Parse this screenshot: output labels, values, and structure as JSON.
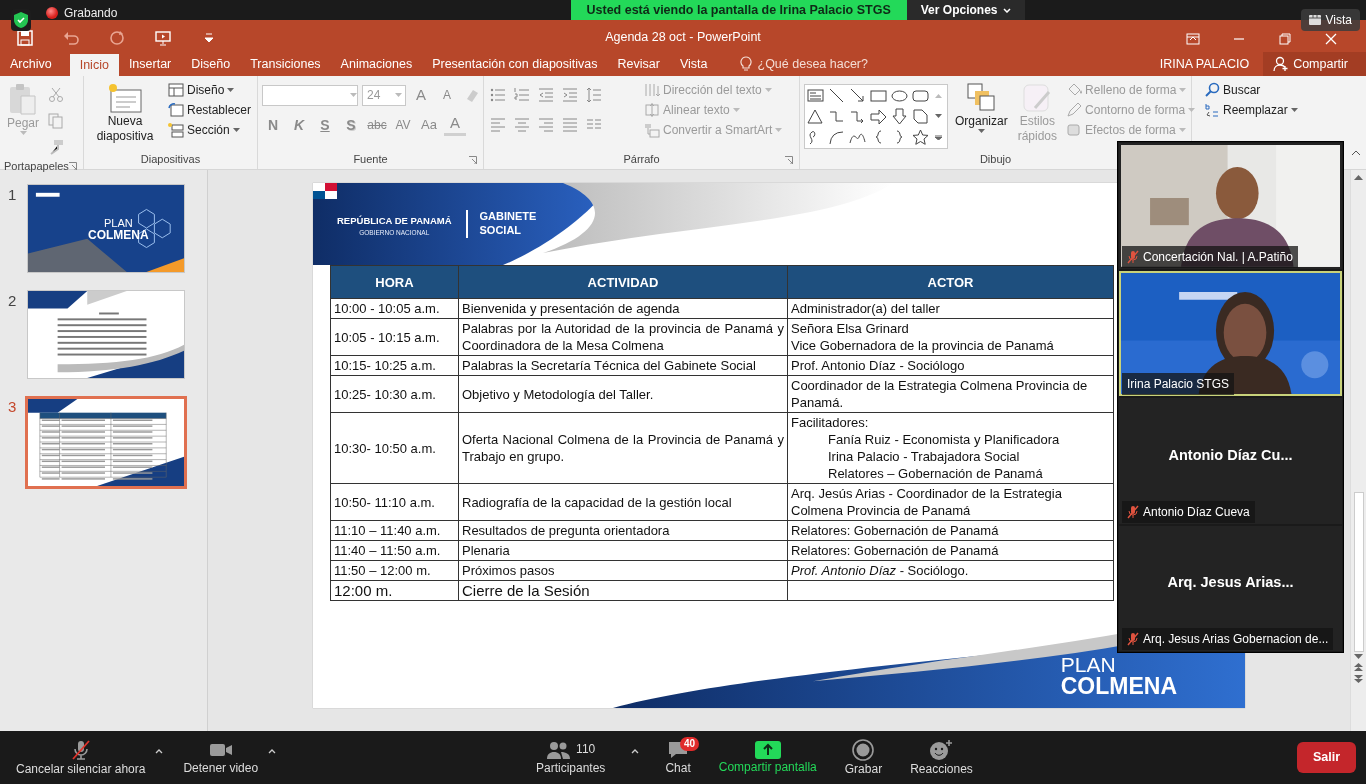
{
  "zoom_bar": {
    "recording_label": "Grabando",
    "banner": "Usted está viendo la pantalla de Irina Palacio STGS",
    "options_button": "Ver Opciones",
    "view_button": "Vista"
  },
  "window": {
    "title": "Agenda 28 oct - PowerPoint"
  },
  "tabs": [
    {
      "label": "Archivo",
      "selected": false
    },
    {
      "label": "Inicio",
      "selected": true
    },
    {
      "label": "Insertar",
      "selected": false
    },
    {
      "label": "Diseño",
      "selected": false
    },
    {
      "label": "Transiciones",
      "selected": false
    },
    {
      "label": "Animaciones",
      "selected": false
    },
    {
      "label": "Presentación con diapositivas",
      "selected": false
    },
    {
      "label": "Revisar",
      "selected": false
    },
    {
      "label": "Vista",
      "selected": false
    }
  ],
  "tell_me": {
    "placeholder": "¿Qué desea hacer?"
  },
  "account": {
    "user": "IRINA PALACIO",
    "share_button": "Compartir"
  },
  "ribbon": {
    "clipboard": {
      "label": "Portapapeles",
      "paste": {
        "label": "Pegar",
        "disabled": true
      }
    },
    "slides": {
      "label": "Diapositivas",
      "new_slide": "Nueva diapositiva",
      "commands": [
        {
          "label": "Diseño",
          "dropdown": true
        },
        {
          "label": "Restablecer",
          "dropdown": false
        },
        {
          "label": "Sección",
          "dropdown": true
        }
      ]
    },
    "font": {
      "label": "Fuente",
      "font_size": "24",
      "size_buttons": [
        {
          "kind": "grow",
          "label": "A"
        },
        {
          "kind": "shrink",
          "label": "A"
        }
      ],
      "format_buttons": [
        {
          "kind": "bold",
          "label": "N"
        },
        {
          "kind": "italic",
          "label": "K"
        },
        {
          "kind": "underline",
          "label": "S"
        },
        {
          "kind": "shadow",
          "label": "S"
        },
        {
          "kind": "strike",
          "label": "abc"
        },
        {
          "kind": "spacing",
          "label": "AV"
        },
        {
          "kind": "case",
          "label": "Aa"
        },
        {
          "kind": "color",
          "label": "A"
        }
      ]
    },
    "paragraph": {
      "label": "Párrafo",
      "commands": [
        {
          "label": "Dirección del texto",
          "disabled": true
        },
        {
          "label": "Alinear texto",
          "disabled": true
        },
        {
          "label": "Convertir a SmartArt",
          "disabled": true
        }
      ]
    },
    "drawing": {
      "label": "Dibujo",
      "arrange": "Organizar",
      "quick_styles": {
        "label": "Estilos rápidos",
        "disabled": true
      },
      "commands": [
        {
          "label": "Relleno de forma",
          "disabled": true
        },
        {
          "label": "Contorno de forma",
          "disabled": true
        },
        {
          "label": "Efectos de forma",
          "disabled": true
        }
      ]
    },
    "editing": {
      "commands": [
        {
          "label": "Buscar",
          "dropdown": false
        },
        {
          "label": "Reemplazar",
          "dropdown": true
        }
      ]
    }
  },
  "slide_thumbnails": [
    {
      "number": "1",
      "selected": false,
      "kind": "title",
      "texts": [
        "PLAN",
        "COLMENA"
      ]
    },
    {
      "number": "2",
      "selected": false,
      "kind": "program"
    },
    {
      "number": "3",
      "selected": true,
      "kind": "table"
    }
  ],
  "slide": {
    "header": {
      "country": "REPÚBLICA DE PANAMÁ",
      "government": "GOBIERNO NACIONAL",
      "cabinet": "GABINETE SOCIAL"
    },
    "table": {
      "columns": [
        "HORA",
        "ACTIVIDAD",
        "ACTOR"
      ],
      "rows": [
        {
          "kind": "item",
          "time": "10:00 - 10:05 a.m.",
          "activity": "Bienvenida y presentación de agenda",
          "actor": [
            "Administrador(a) del taller"
          ]
        },
        {
          "kind": "item",
          "time": "10:05 - 10:15 a.m.",
          "activity": "Palabras por la Autoridad de la provincia de Panamá y Coordinadora de la Mesa Colmena",
          "actor": [
            "Señora Elsa Grinard",
            "Vice Gobernadora de la provincia de Panamá"
          ]
        },
        {
          "kind": "item",
          "time": "10:15- 10:25 a.m.",
          "activity": "Palabras la Secretaría Técnica del Gabinete Social",
          "actor": [
            "Prof. Antonio Díaz - Sociólogo"
          ]
        },
        {
          "kind": "item",
          "time": "10:25- 10:30 a.m.",
          "activity": "Objetivo y Metodología del Taller.",
          "actor": [
            "Coordinador de la Estrategia Colmena Provincia de Panamá."
          ]
        },
        {
          "kind": "item",
          "time": "10:30- 10:50 a.m.",
          "activity": "Oferta Nacional Colmena de la Provincia de Panamá y Trabajo en grupo.",
          "actor": [
            "Facilitadores:"
          ],
          "actor_items": [
            "Fanía Ruiz - Economista y Planificadora",
            "Irina Palacio - Trabajadora Social",
            "Relatores – Gobernación de Panamá"
          ]
        },
        {
          "kind": "item",
          "time": "10:50- 11:10 a.m.",
          "activity": "Radiografía de la capacidad de la gestión local",
          "actor": [
            "Arq. Jesús Arias  - Coordinador de la Estrategia Colmena Provincia de Panamá"
          ]
        },
        {
          "kind": "item",
          "time": "11:10 – 11:40 a.m.",
          "activity": "Resultados de pregunta orientadora",
          "actor": [
            "Relatores:  Gobernación de Panamá"
          ]
        },
        {
          "kind": "item",
          "time": "11:40 – 11:50 a.m.",
          "activity": "Plenaria",
          "actor": [
            "Relatores: Gobernación de Panamá"
          ]
        },
        {
          "kind": "item",
          "time": "11:50 – 12:00 m.",
          "activity": "Próximos pasos",
          "actor": [
            "*Prof. Antonio Díaz*  - Sociólogo."
          ]
        },
        {
          "kind": "closing",
          "time": "12:00 m.",
          "activity": "Cierre de la Sesión"
        }
      ]
    },
    "footer_logo": [
      "PLAN",
      "COLMENA"
    ]
  },
  "participants": [
    {
      "kind": "video",
      "label": "Concertación Nal. | A.Patiño",
      "muted": true,
      "speaking": false
    },
    {
      "kind": "video",
      "label": "Irina Palacio STGS",
      "muted": false,
      "speaking": true
    },
    {
      "kind": "name",
      "display_name": "Antonio Díaz Cu...",
      "label": "Antonio Díaz Cueva",
      "muted": true,
      "speaking": false
    },
    {
      "kind": "name",
      "display_name": "Arq. Jesus Arias...",
      "label": "Arq. Jesus Arias Gobernacion de...",
      "muted": true,
      "speaking": false
    }
  ],
  "toolbar": {
    "items": [
      {
        "kind": "audio",
        "label": "Cancelar silenciar ahora",
        "muted": true
      },
      {
        "kind": "video",
        "label": "Detener video"
      },
      {
        "kind": "participants",
        "label": "Participantes",
        "count": "110"
      },
      {
        "kind": "chat",
        "label": "Chat",
        "badge": "40"
      },
      {
        "kind": "share",
        "label": "Compartir pantalla"
      },
      {
        "kind": "record",
        "label": "Grabar"
      },
      {
        "kind": "reactions",
        "label": "Reacciones"
      }
    ],
    "leave_button": "Salir"
  }
}
